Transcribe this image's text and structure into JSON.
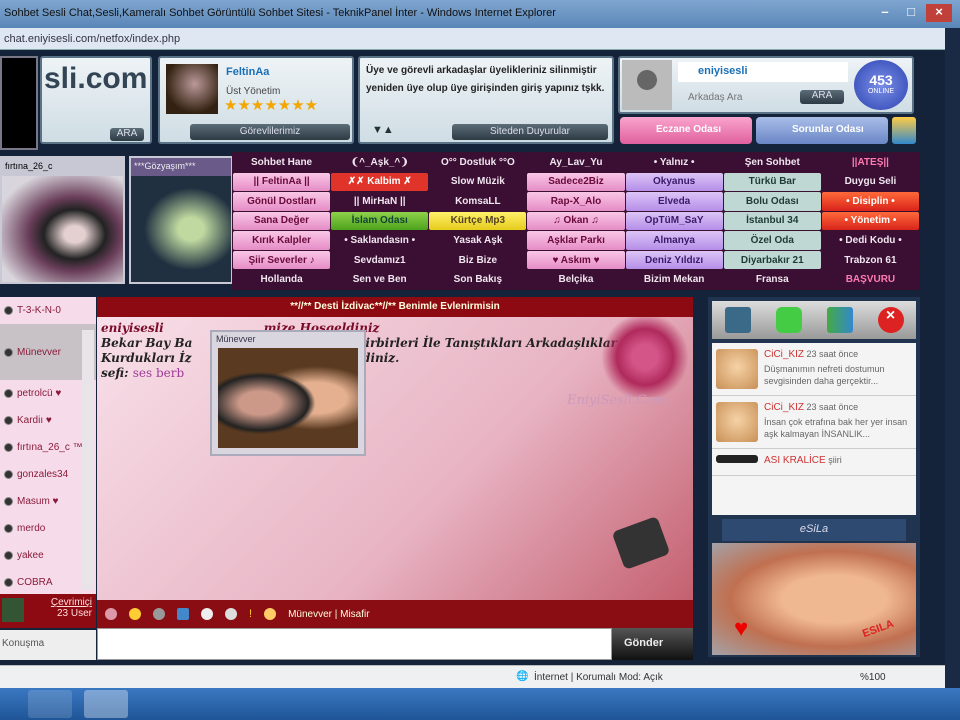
{
  "window": {
    "title": "Sohbet Sesli Chat,Sesli,Kameralı Sohbet Görüntülü Sohbet Sitesi - TeknikPanel İnter - Windows Internet Explorer",
    "url": "chat.eniyisesli.com/netfox/index.php"
  },
  "header": {
    "logo": "sli.com",
    "go": "ARA",
    "staff": {
      "name": "FeltinAa",
      "rank": "Üst Yönetim",
      "stars": 7,
      "button": "Görevlilerimiz"
    },
    "notice": {
      "text": "Üye ve görevli arkadaşlar üyelikleriniz silinmiştir yeniden üye olup üye girişinden giriş yapınız tşkk.",
      "button": "Siteden Duyurular"
    },
    "user": {
      "name": "eniyisesli",
      "search_placeholder": "Arkadaş Ara",
      "search_btn": "ARA",
      "online_count": "453",
      "online_label": "ONLINE",
      "btn1": "Eczane Odası",
      "btn2": "Sorunlar Odası"
    }
  },
  "cams": [
    {
      "title": "fırtına_26_c"
    },
    {
      "title": "***Gözyaşım***"
    }
  ],
  "rooms": [
    [
      {
        "l": "Sohbet Hane",
        "s": "dark"
      },
      {
        "l": "❨^_Aşk_^❩",
        "s": "dark"
      },
      {
        "l": "O°° Dostluk °°O",
        "s": "dark"
      },
      {
        "l": "Ay_Lav_Yu",
        "s": "dark"
      },
      {
        "l": "• Yalnız •",
        "s": "dark"
      },
      {
        "l": "Şen Sohbet",
        "s": "dark"
      },
      {
        "l": "||ATEŞ||",
        "s": "ates"
      }
    ],
    [
      {
        "l": "|| FeltinAa ||",
        "s": "pink"
      },
      {
        "l": "✗✗ Kalbim ✗",
        "s": "redlabel"
      },
      {
        "l": "Slow Müzik",
        "s": "dark"
      },
      {
        "l": "Sadece2Biz",
        "s": "pink"
      },
      {
        "l": "Okyanus",
        "s": "purple"
      },
      {
        "l": "Türkü Bar",
        "s": "teal"
      },
      {
        "l": "Duygu Seli",
        "s": "dark"
      }
    ],
    [
      {
        "l": "Gönül Dostları",
        "s": "pink"
      },
      {
        "l": "|| MirHaN ||",
        "s": "dark"
      },
      {
        "l": "KomsaLL",
        "s": "dark"
      },
      {
        "l": "Rap-X_Alo",
        "s": "pink"
      },
      {
        "l": "Elveda",
        "s": "purple"
      },
      {
        "l": "Bolu Odası",
        "s": "teal"
      },
      {
        "l": "• Disiplin •",
        "s": "red"
      }
    ],
    [
      {
        "l": "Sana Değer",
        "s": "pink"
      },
      {
        "l": "İslam Odası",
        "s": "green"
      },
      {
        "l": "Kürtçe Mp3",
        "s": "yellow"
      },
      {
        "l": "♫ Okan ♫",
        "s": "pink"
      },
      {
        "l": "OpTüM_SaY",
        "s": "purple"
      },
      {
        "l": "İstanbul 34",
        "s": "teal"
      },
      {
        "l": "• Yönetim •",
        "s": "red"
      }
    ],
    [
      {
        "l": "Kırık Kalpler",
        "s": "pink"
      },
      {
        "l": "• Saklandasın •",
        "s": "dark"
      },
      {
        "l": "Yasak Aşk",
        "s": "dark"
      },
      {
        "l": "Aşklar Parkı",
        "s": "pink"
      },
      {
        "l": "Almanya",
        "s": "purple"
      },
      {
        "l": "Özel Oda",
        "s": "teal"
      },
      {
        "l": "• Dedi Kodu •",
        "s": "dark"
      }
    ],
    [
      {
        "l": "Şiir Severler ♪",
        "s": "pink"
      },
      {
        "l": "Sevdamız1",
        "s": "dark"
      },
      {
        "l": "Biz Bize",
        "s": "dark"
      },
      {
        "l": "♥ Askım ♥",
        "s": "pink"
      },
      {
        "l": "Deniz Yıldızı",
        "s": "purple"
      },
      {
        "l": "Diyarbakır 21",
        "s": "teal"
      },
      {
        "l": "Trabzon 61",
        "s": "dark"
      }
    ],
    [
      {
        "l": "Hollanda",
        "s": "dark"
      },
      {
        "l": "Sen ve Ben",
        "s": "dark"
      },
      {
        "l": "Son Bakış",
        "s": "dark"
      },
      {
        "l": "Belçika",
        "s": "dark"
      },
      {
        "l": "Bizim Mekan",
        "s": "dark"
      },
      {
        "l": "Fransa",
        "s": "dark"
      },
      {
        "l": "BAŞVURU",
        "s": "ates"
      }
    ]
  ],
  "users": {
    "list": [
      "T-3-K-N-0",
      "Münevver",
      "petrolcü ♥",
      "Kardiı ♥",
      "fırtına_26_c ™",
      "gonzales34",
      "Masum ♥",
      "merdo",
      "yakee",
      "COBRA"
    ],
    "selected": 1,
    "online_label": "Çevrimiçi",
    "count": "23 User",
    "tab": "Konuşma"
  },
  "chat": {
    "header": "**//** Desti İzdivac**//** Benimle Evlenirmisin",
    "lines": [
      [
        "eniyisesli",
        "mize Hoşgeldiniz"
      ],
      [
        "Bekar Bay Ba",
        "n Birbirleri İle Tanıştıkları Arkadaşlıklar"
      ],
      [
        "Kurdukları İz",
        "geldiniz."
      ]
    ],
    "sefi_label": "sefi:",
    "sefi_text": "ses berb",
    "popup_title": "Münevver",
    "watermark": "EniyiSesli.Com",
    "current_user": "Münevver | Misafir",
    "send": "Gönder"
  },
  "feed": {
    "posts": [
      {
        "name": "CiCi_KIZ",
        "time": "23 saat önce",
        "text": "Düşmanımın nefreti dostumun sevgisinden daha gerçektir..."
      },
      {
        "name": "CiCi_KIZ",
        "time": "23 saat önce",
        "text": "İnsan çok etrafına bak her yer insan aşk kalmayan İNSANLIK..."
      },
      {
        "name": "ASI KRALİCE",
        "time": "şiiri",
        "text": ""
      }
    ],
    "banner": "eSiLa",
    "ad_text": "ESILA"
  },
  "status": {
    "zone": "İnternet | Korumalı Mod: Açık",
    "zoom": "%100"
  }
}
